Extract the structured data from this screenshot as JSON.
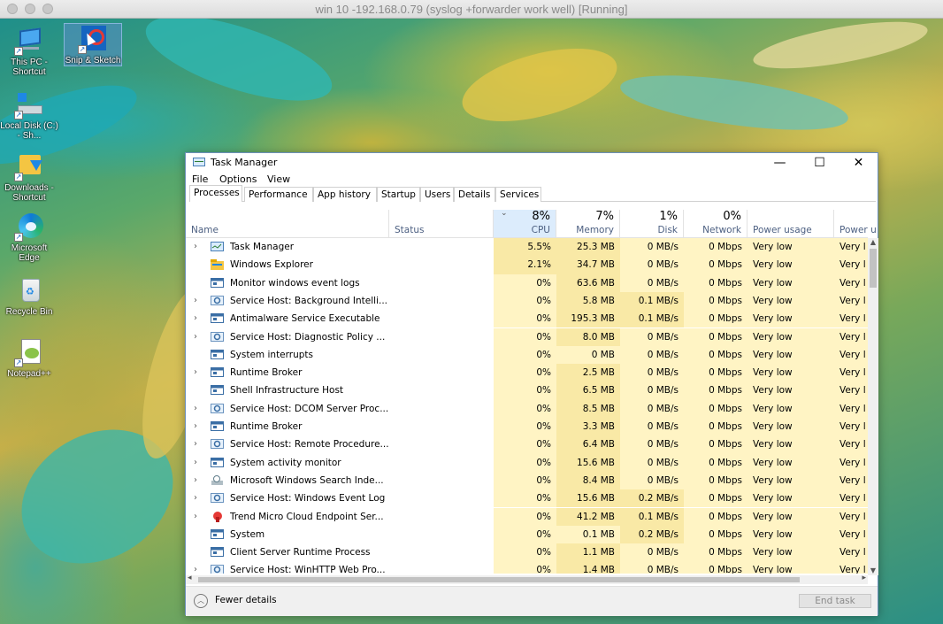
{
  "vm": {
    "title": "win 10 -192.168.0.79  (syslog +forwarder work well) [Running]"
  },
  "desktop": {
    "icons": [
      {
        "label": "This PC - Shortcut",
        "icon": "this-pc-icon"
      },
      {
        "label": "Snip & Sketch",
        "icon": "snip-sketch-icon"
      },
      {
        "label": "Local Disk (C:) - Sh...",
        "icon": "local-disk-icon"
      },
      {
        "label": "Downloads - Shortcut",
        "icon": "downloads-icon"
      },
      {
        "label": "Microsoft Edge",
        "icon": "edge-icon"
      },
      {
        "label": "Recycle Bin",
        "icon": "recycle-bin-icon"
      },
      {
        "label": "Notepad++",
        "icon": "notepad-plus-plus-icon"
      }
    ]
  },
  "taskmanager": {
    "title": "Task Manager",
    "window_buttons": {
      "minimize": "—",
      "maximize": "☐",
      "close": "✕"
    },
    "menu": [
      "File",
      "Options",
      "View"
    ],
    "tabs": [
      "Processes",
      "Performance",
      "App history",
      "Startup",
      "Users",
      "Details",
      "Services"
    ],
    "active_tab": "Processes",
    "columns": {
      "name": {
        "label": "Name"
      },
      "status": {
        "label": "Status"
      },
      "cpu": {
        "label": "CPU",
        "pct": "8%"
      },
      "memory": {
        "label": "Memory",
        "pct": "7%"
      },
      "disk": {
        "label": "Disk",
        "pct": "1%"
      },
      "network": {
        "label": "Network",
        "pct": "0%"
      },
      "power": {
        "label": "Power usage"
      },
      "power_trend": {
        "label": "Power u"
      }
    },
    "sort_arrow": "⌄",
    "processes": [
      {
        "name": "Task Manager",
        "expandable": true,
        "icon": "task-manager-icon",
        "cpu": "5.5%",
        "memory": "25.3 MB",
        "disk": "0 MB/s",
        "network": "0 Mbps",
        "power": "Very low",
        "power_trend": "Very l"
      },
      {
        "name": "Windows Explorer",
        "expandable": false,
        "icon": "folder-icon",
        "cpu": "2.1%",
        "memory": "34.7 MB",
        "disk": "0 MB/s",
        "network": "0 Mbps",
        "power": "Very low",
        "power_trend": "Very l"
      },
      {
        "name": "Monitor windows event logs",
        "expandable": false,
        "icon": "window-icon",
        "cpu": "0%",
        "memory": "63.6 MB",
        "disk": "0 MB/s",
        "network": "0 Mbps",
        "power": "Very low",
        "power_trend": "Very l"
      },
      {
        "name": "Service Host: Background Intelli...",
        "expandable": true,
        "icon": "gear-icon",
        "cpu": "0%",
        "memory": "5.8 MB",
        "disk": "0.1 MB/s",
        "network": "0 Mbps",
        "power": "Very low",
        "power_trend": "Very l"
      },
      {
        "name": "Antimalware Service Executable",
        "expandable": true,
        "icon": "window-icon",
        "cpu": "0%",
        "memory": "195.3 MB",
        "disk": "0.1 MB/s",
        "network": "0 Mbps",
        "power": "Very low",
        "power_trend": "Very l"
      },
      {
        "name": "Service Host: Diagnostic Policy ...",
        "expandable": true,
        "icon": "gear-icon",
        "cpu": "0%",
        "memory": "8.0 MB",
        "disk": "0 MB/s",
        "network": "0 Mbps",
        "power": "Very low",
        "power_trend": "Very l"
      },
      {
        "name": "System interrupts",
        "expandable": false,
        "icon": "window-icon",
        "cpu": "0%",
        "memory": "0 MB",
        "disk": "0 MB/s",
        "network": "0 Mbps",
        "power": "Very low",
        "power_trend": "Very l"
      },
      {
        "name": "Runtime Broker",
        "expandable": true,
        "icon": "window-icon",
        "cpu": "0%",
        "memory": "2.5 MB",
        "disk": "0 MB/s",
        "network": "0 Mbps",
        "power": "Very low",
        "power_trend": "Very l"
      },
      {
        "name": "Shell Infrastructure Host",
        "expandable": false,
        "icon": "window-icon",
        "cpu": "0%",
        "memory": "6.5 MB",
        "disk": "0 MB/s",
        "network": "0 Mbps",
        "power": "Very low",
        "power_trend": "Very l"
      },
      {
        "name": "Service Host: DCOM Server Proc...",
        "expandable": true,
        "icon": "gear-icon",
        "cpu": "0%",
        "memory": "8.5 MB",
        "disk": "0 MB/s",
        "network": "0 Mbps",
        "power": "Very low",
        "power_trend": "Very l"
      },
      {
        "name": "Runtime Broker",
        "expandable": true,
        "icon": "window-icon",
        "cpu": "0%",
        "memory": "3.3 MB",
        "disk": "0 MB/s",
        "network": "0 Mbps",
        "power": "Very low",
        "power_trend": "Very l"
      },
      {
        "name": "Service Host: Remote Procedure...",
        "expandable": true,
        "icon": "gear-icon",
        "cpu": "0%",
        "memory": "6.4 MB",
        "disk": "0 MB/s",
        "network": "0 Mbps",
        "power": "Very low",
        "power_trend": "Very l"
      },
      {
        "name": "System activity monitor",
        "expandable": true,
        "icon": "window-icon",
        "cpu": "0%",
        "memory": "15.6 MB",
        "disk": "0 MB/s",
        "network": "0 Mbps",
        "power": "Very low",
        "power_trend": "Very l"
      },
      {
        "name": "Microsoft Windows Search Inde...",
        "expandable": true,
        "icon": "search-indexer-icon",
        "cpu": "0%",
        "memory": "8.4 MB",
        "disk": "0 MB/s",
        "network": "0 Mbps",
        "power": "Very low",
        "power_trend": "Very l"
      },
      {
        "name": "Service Host: Windows Event Log",
        "expandable": true,
        "icon": "gear-icon",
        "cpu": "0%",
        "memory": "15.6 MB",
        "disk": "0.2 MB/s",
        "network": "0 Mbps",
        "power": "Very low",
        "power_trend": "Very l"
      },
      {
        "name": "Trend Micro Cloud Endpoint Ser...",
        "expandable": true,
        "icon": "trend-micro-icon",
        "cpu": "0%",
        "memory": "41.2 MB",
        "disk": "0.1 MB/s",
        "network": "0 Mbps",
        "power": "Very low",
        "power_trend": "Very l"
      },
      {
        "name": "System",
        "expandable": false,
        "icon": "window-icon",
        "cpu": "0%",
        "memory": "0.1 MB",
        "disk": "0.2 MB/s",
        "network": "0 Mbps",
        "power": "Very low",
        "power_trend": "Very l"
      },
      {
        "name": "Client Server Runtime Process",
        "expandable": false,
        "icon": "window-icon",
        "cpu": "0%",
        "memory": "1.1 MB",
        "disk": "0 MB/s",
        "network": "0 Mbps",
        "power": "Very low",
        "power_trend": "Very l"
      },
      {
        "name": "Service Host: WinHTTP Web Pro...",
        "expandable": true,
        "icon": "gear-icon",
        "cpu": "0%",
        "memory": "1.4 MB",
        "disk": "0 MB/s",
        "network": "0 Mbps",
        "power": "Very low",
        "power_trend": "Very l"
      }
    ],
    "footer": {
      "fewer_details": "Fewer details",
      "end_task": "End task"
    }
  },
  "colors": {
    "heat_high": "#f9e9a6",
    "heat_low": "#fff4c4",
    "sorted_header": "#dcecfc",
    "window_border": "#6b8fb8"
  }
}
